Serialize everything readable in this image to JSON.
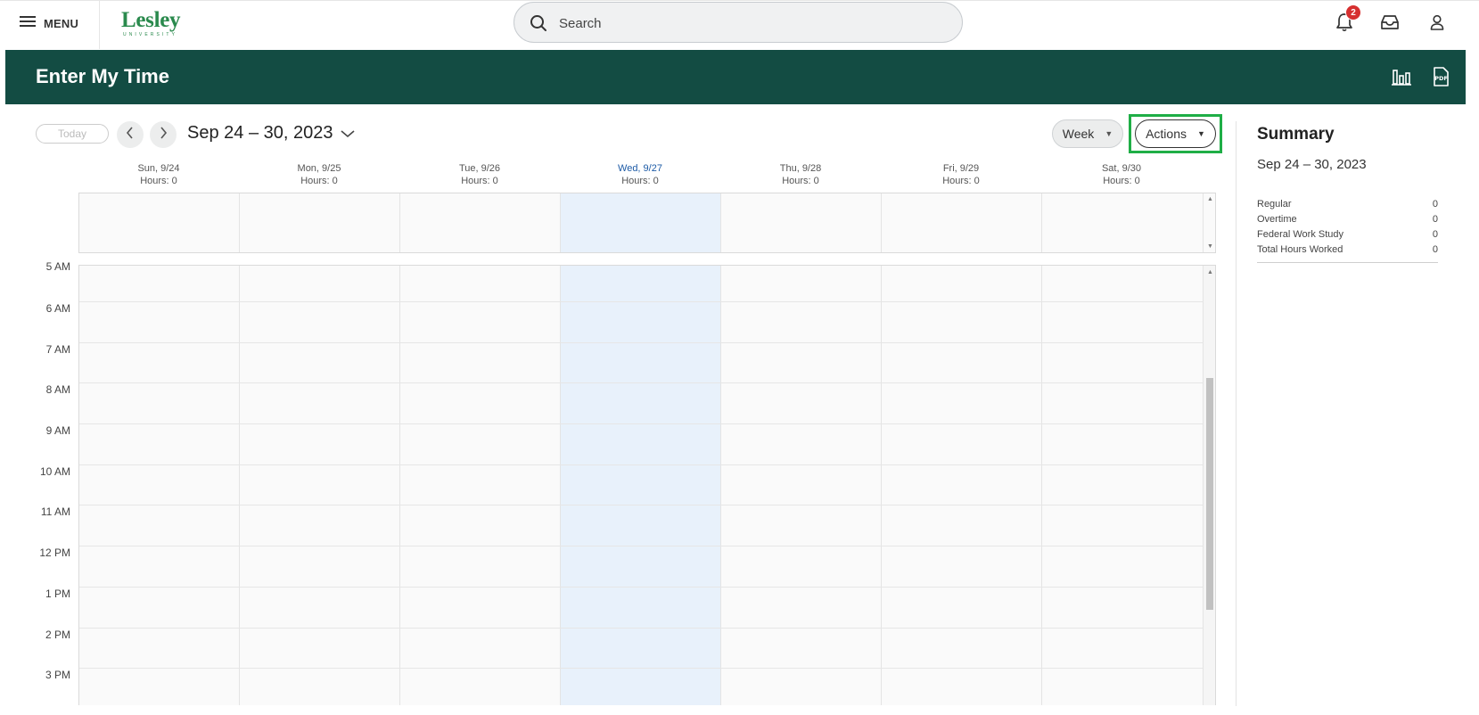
{
  "topbar": {
    "menu_label": "MENU",
    "logo_word": "Lesley",
    "logo_sub": "UNIVERSITY",
    "search_placeholder": "Search",
    "notification_count": "2"
  },
  "header": {
    "title": "Enter My Time",
    "bg_color": "#134c43"
  },
  "toolbar": {
    "today_label": "Today",
    "date_range": "Sep 24 – 30, 2023",
    "view_select": "Week",
    "actions_label": "Actions",
    "highlight_color": "#1fae46"
  },
  "days": [
    {
      "label": "Sun, 9/24",
      "hours": "Hours: 0",
      "today": false
    },
    {
      "label": "Mon, 9/25",
      "hours": "Hours: 0",
      "today": false
    },
    {
      "label": "Tue, 9/26",
      "hours": "Hours: 0",
      "today": false
    },
    {
      "label": "Wed, 9/27",
      "hours": "Hours: 0",
      "today": true
    },
    {
      "label": "Thu, 9/28",
      "hours": "Hours: 0",
      "today": false
    },
    {
      "label": "Fri, 9/29",
      "hours": "Hours: 0",
      "today": false
    },
    {
      "label": "Sat, 9/30",
      "hours": "Hours: 0",
      "today": false
    }
  ],
  "hours": [
    "5 AM",
    "6 AM",
    "7 AM",
    "8 AM",
    "9 AM",
    "10 AM",
    "11 AM",
    "12 PM",
    "1 PM",
    "2 PM",
    "3 PM"
  ],
  "summary": {
    "title": "Summary",
    "range": "Sep 24 – 30, 2023",
    "rows": [
      {
        "label": "Regular",
        "value": "0"
      },
      {
        "label": "Overtime",
        "value": "0"
      },
      {
        "label": "Federal Work Study",
        "value": "0"
      },
      {
        "label": "Total Hours Worked",
        "value": "0"
      }
    ]
  },
  "icons": {
    "menu": "hamburger-icon",
    "search": "search-icon",
    "notifications": "bell-icon",
    "inbox": "inbox-icon",
    "profile": "user-icon",
    "chart": "bar-chart-icon",
    "pdf": "pdf-icon"
  }
}
